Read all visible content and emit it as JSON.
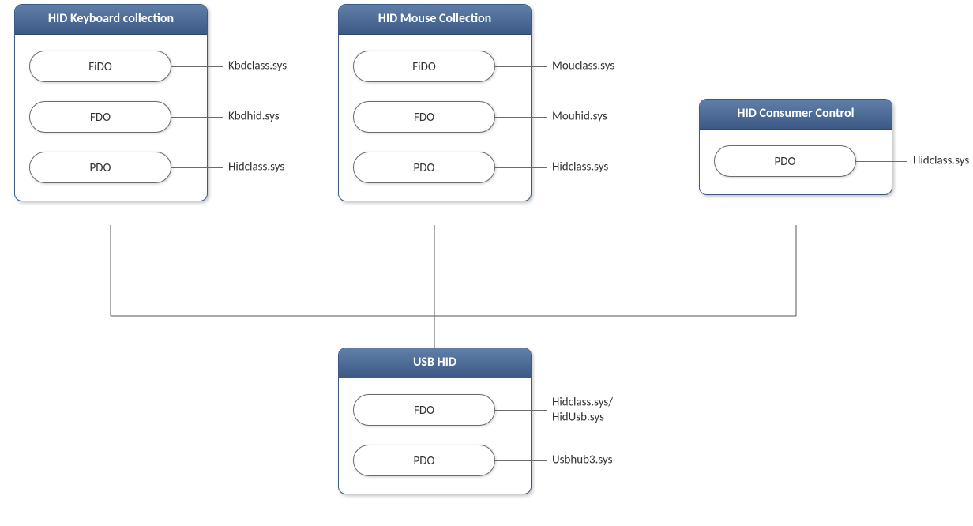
{
  "diagram": {
    "keyboard": {
      "title": "HID Keyboard collection",
      "rows": [
        {
          "name": "FiDO",
          "label": "Kbdclass.sys"
        },
        {
          "name": "FDO",
          "label": "Kbdhid.sys"
        },
        {
          "name": "PDO",
          "label": "Hidclass.sys"
        }
      ]
    },
    "mouse": {
      "title": "HID Mouse Collection",
      "rows": [
        {
          "name": "FiDO",
          "label": "Mouclass.sys"
        },
        {
          "name": "FDO",
          "label": "Mouhid.sys"
        },
        {
          "name": "PDO",
          "label": "Hidclass.sys"
        }
      ]
    },
    "consumer": {
      "title": "HID Consumer Control",
      "rows": [
        {
          "name": "PDO",
          "label": "Hidclass.sys"
        }
      ]
    },
    "usb": {
      "title": "USB HID",
      "rows": [
        {
          "name": "FDO",
          "label": "Hidclass.sys/\nHidUsb.sys"
        },
        {
          "name": "PDO",
          "label": "Usbhub3.sys"
        }
      ]
    }
  }
}
